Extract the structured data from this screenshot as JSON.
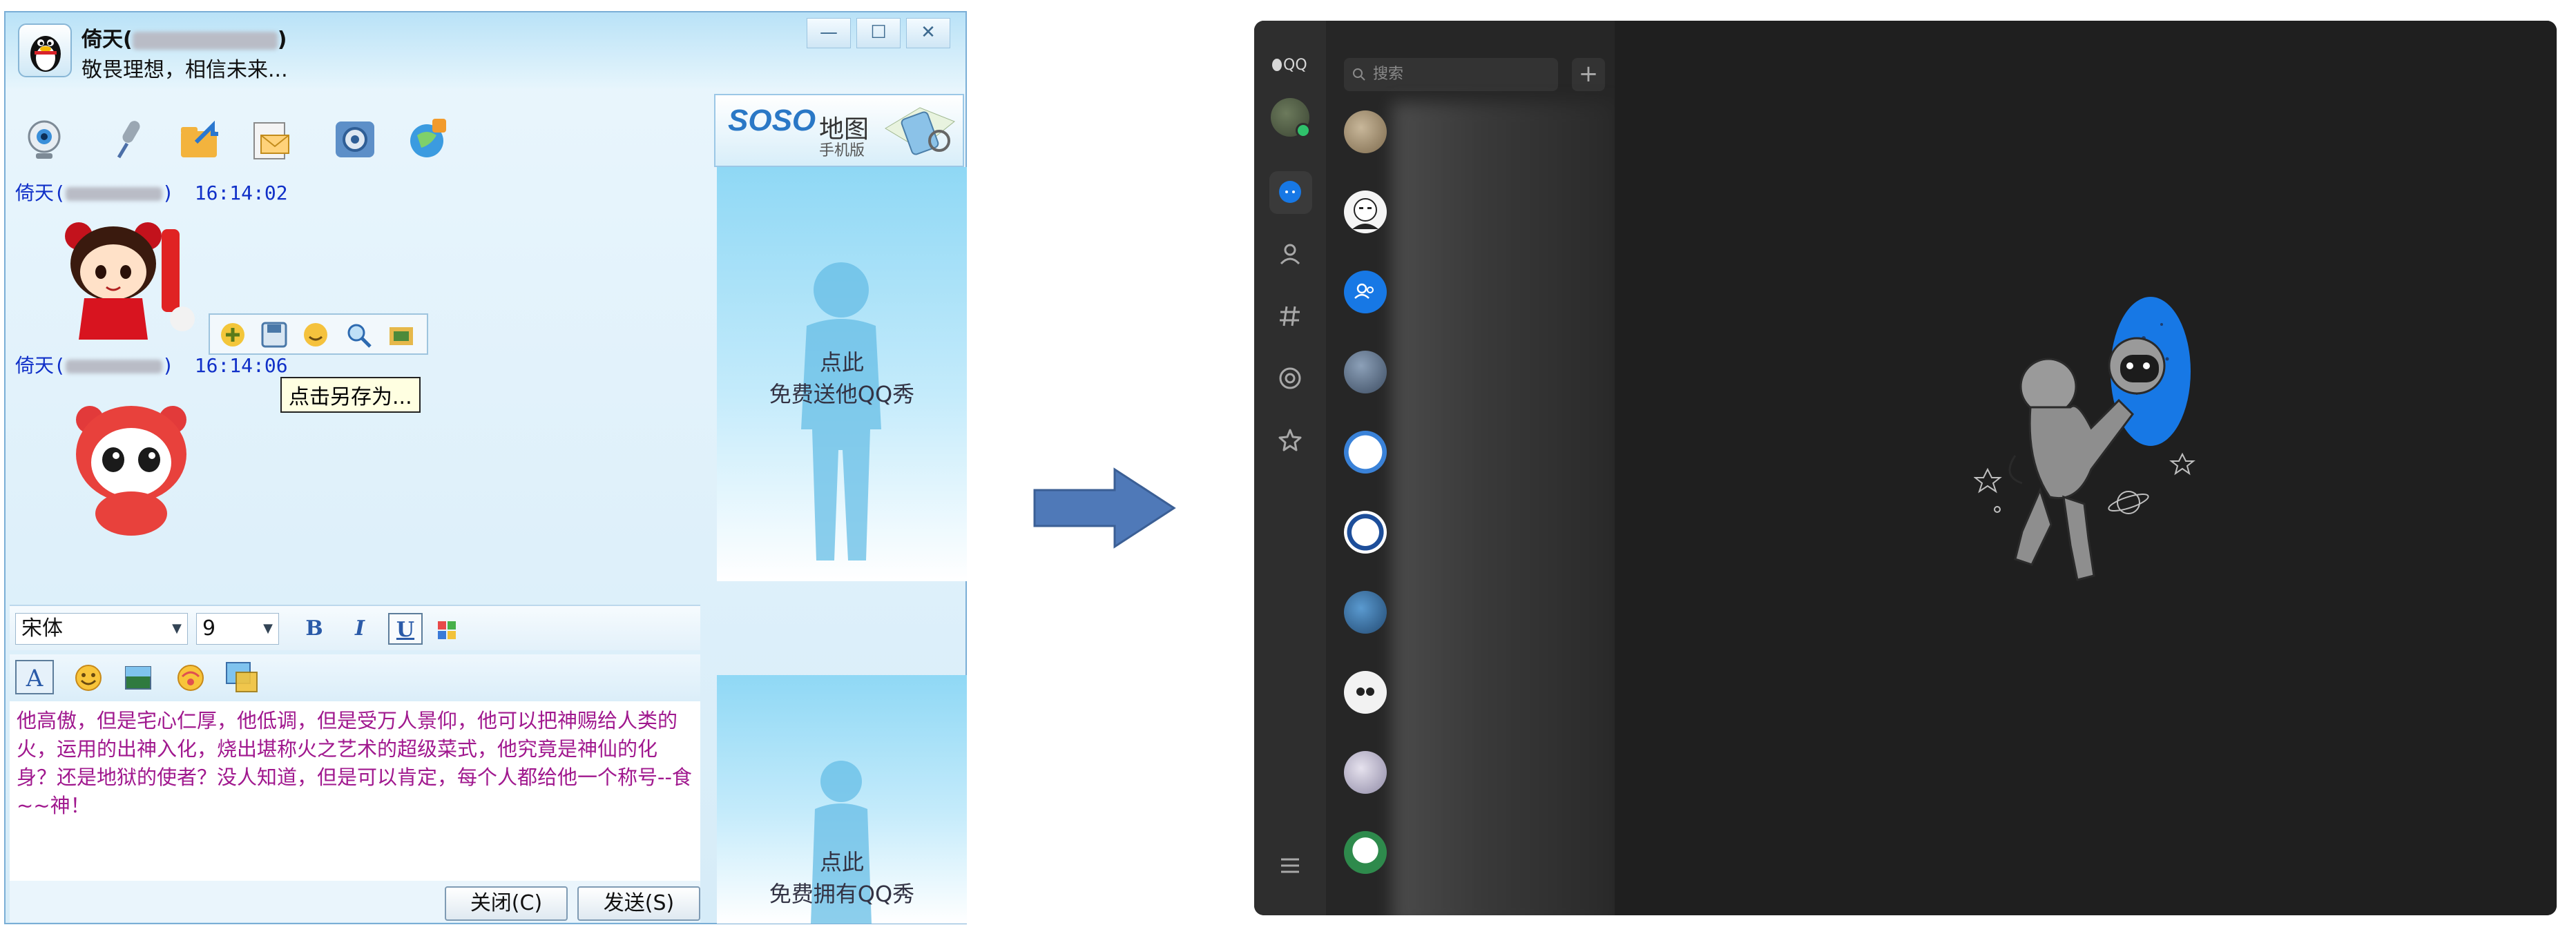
{
  "left_window": {
    "contact_name": "倚天(",
    "contact_name_close": ")",
    "signature": "敬畏理想，相信未来...",
    "controls": {
      "minimize": "—",
      "maximize": "☐",
      "close": "✕"
    },
    "toolbar_icons": [
      "video-icon",
      "microphone-icon",
      "file-transfer-icon",
      "email-icon",
      "settings-icon",
      "app-icon"
    ],
    "ad": {
      "brand": "SOSO",
      "brand_suffix": "地图",
      "sub": "手机版"
    },
    "messages": [
      {
        "sender": "倚天(",
        "sender_close": ")",
        "time": "16:14:02"
      },
      {
        "sender": "倚天(",
        "sender_close": ")",
        "time": "16:14:06"
      }
    ],
    "tooltip": "点击另存为...",
    "show_panels": [
      {
        "line1": "点此",
        "line2": "免费送他QQ秀"
      },
      {
        "line1": "点此",
        "line2": "免费拥有QQ秀"
      }
    ],
    "font": {
      "family_value": "宋体",
      "size_value": "9"
    },
    "format_buttons": {
      "bold": "B",
      "italic": "I",
      "underline": "U"
    },
    "input_text": "他高傲，但是宅心仁厚，他低调，但是受万人景仰，他可以把神赐给人类的火，运用的出神入化，烧出堪称火之艺术的超级菜式，他究竟是神仙的化身？还是地狱的使者？没人知道，但是可以肯定，每个人都给他一个称号--食~~神！",
    "close_button": "关闭(C)",
    "send_button": "发送(S)"
  },
  "right_window": {
    "app_label": "QQ",
    "search_placeholder": "搜索",
    "plus_label": "+",
    "menu_icon": "menu-icon"
  },
  "colors": {
    "arrow": "#4f79b8",
    "dark_bg": "#1f1f1f",
    "accent_blue": "#1778e5"
  }
}
